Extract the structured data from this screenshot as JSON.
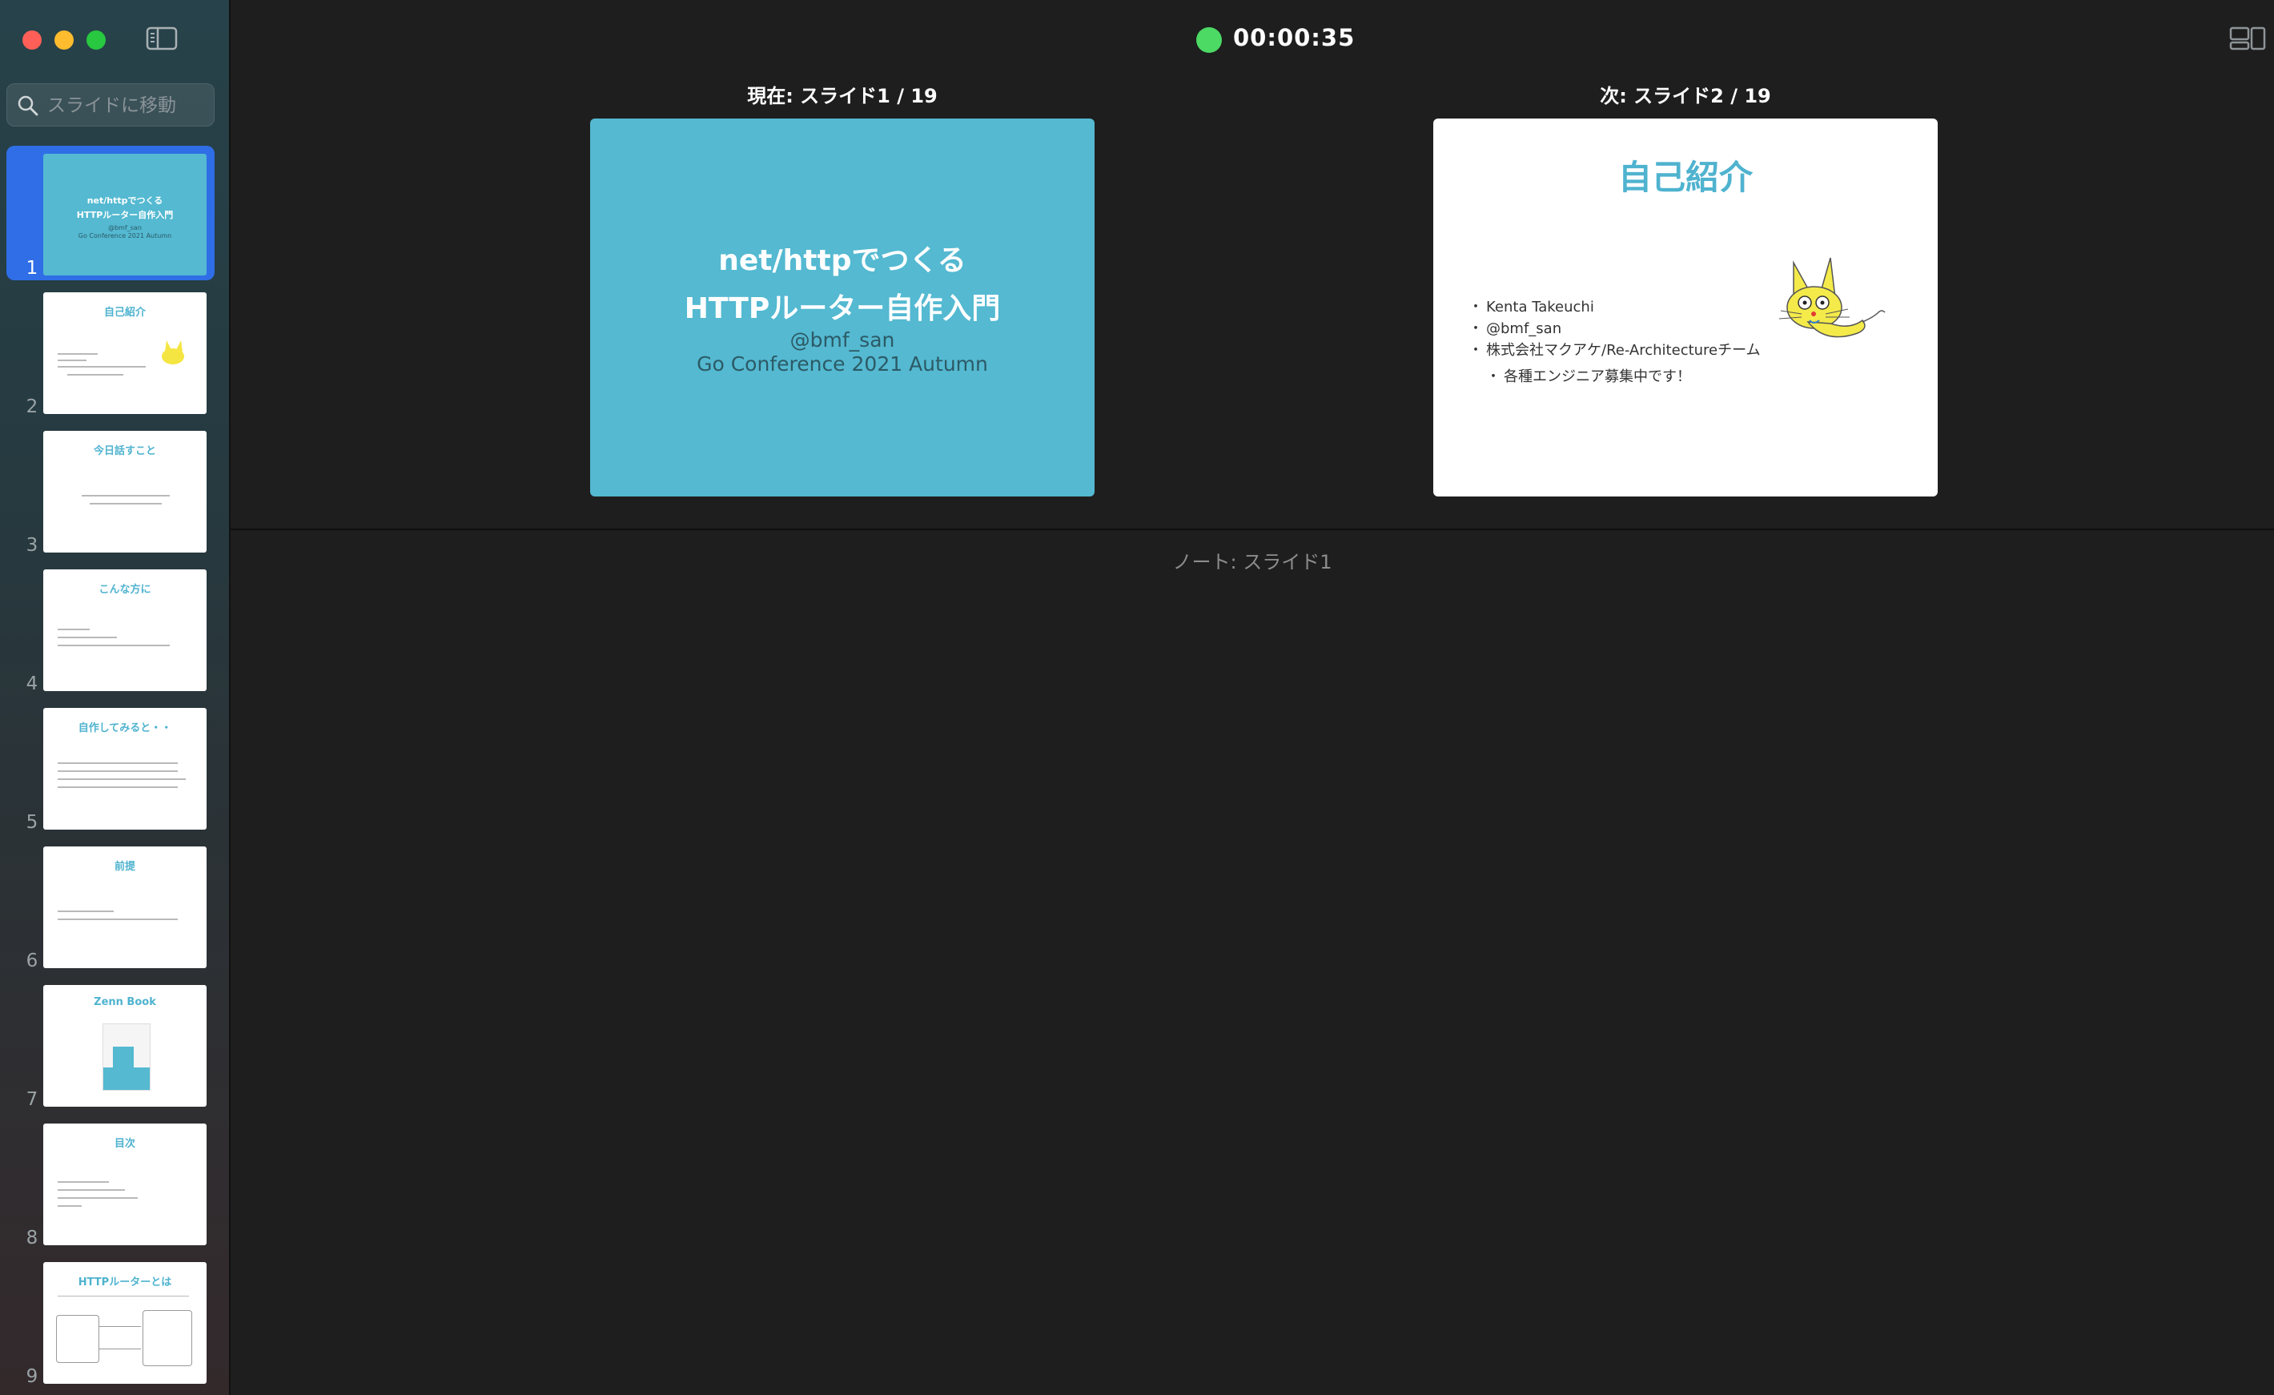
{
  "window": {
    "search_placeholder": "スライドに移動"
  },
  "header": {
    "timer": "00:00:35",
    "timer_status_color": "#4cd964"
  },
  "current": {
    "label": "現在: スライド1 / 19",
    "title_line1": "net/httpでつくる",
    "title_line2": "HTTPルーター自作入門",
    "handle": "@bmf_san",
    "event": "Go Conference 2021 Autumn",
    "background": "#54b9d1"
  },
  "next": {
    "label": "次: スライド2 / 19",
    "title": "自己紹介",
    "bullets": [
      "Kenta Takeuchi",
      "@bmf_san",
      "株式会社マクアケ/Re-Architectureチーム"
    ],
    "sub_bullet": "各種エンジニア募集中です！"
  },
  "notes": {
    "label": "ノート: スライド1"
  },
  "thumbnails": [
    {
      "num": "1",
      "title_line1": "net/httpでつくる",
      "title_line2": "HTTPルーター自作入門",
      "handle": "@bmf_san",
      "event": "Go Conference 2021 Autumn"
    },
    {
      "num": "2",
      "title": "自己紹介"
    },
    {
      "num": "3",
      "title": "今日話すこと"
    },
    {
      "num": "4",
      "title": "こんな方に"
    },
    {
      "num": "5",
      "title": "自作してみると・・"
    },
    {
      "num": "6",
      "title": "前提"
    },
    {
      "num": "7",
      "title": "Zenn Book"
    },
    {
      "num": "8",
      "title": "目次"
    },
    {
      "num": "9",
      "title": "HTTPルーターとは"
    }
  ]
}
